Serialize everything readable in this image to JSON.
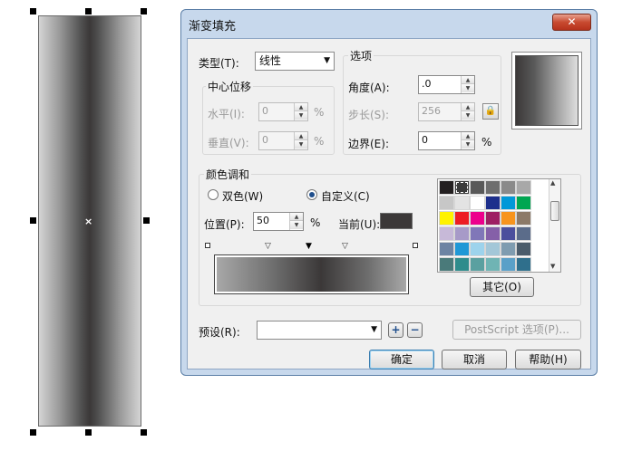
{
  "dialog": {
    "title": "渐变填充",
    "close_glyph": "✕",
    "type_label": "类型(T):",
    "type_value": "线性",
    "center_offset": {
      "group_label": "中心位移",
      "horizontal_label": "水平(I):",
      "horizontal_value": "0",
      "vertical_label": "垂直(V):",
      "vertical_value": "0",
      "percent": "%"
    },
    "options": {
      "group_label": "选项",
      "angle_label": "角度(A):",
      "angle_value": ".0",
      "steps_label": "步长(S):",
      "steps_value": "256",
      "edge_label": "边界(E):",
      "edge_value": "0",
      "percent": "%"
    },
    "color_blend": {
      "group_label": "颜色调和",
      "two_color_label": "双色(W)",
      "custom_label": "自定义(C)",
      "selected": "custom",
      "position_label": "位置(P):",
      "position_value": "50",
      "percent": "%",
      "current_label": "当前(U):",
      "current_color": "#3b3838",
      "other_button": "其它(O)"
    },
    "palette": [
      "#231f20",
      "#3a3a3a",
      "#595959",
      "#6e6e6e",
      "#8a8a8a",
      "#a8a8a8",
      "#c7c7c7",
      "#e3e3e3",
      "#ffffff",
      "#1d2f8c",
      "#0098d8",
      "#00a651",
      "#fff200",
      "#ed1c24",
      "#ec008c",
      "#9e1f63",
      "#f7941d",
      "#8c7a68",
      "#c7b9d8",
      "#a79ac8",
      "#8077b8",
      "#8560a8",
      "#4b4f9d",
      "#5b6c8a",
      "#6d84a3",
      "#1f98d6",
      "#9dd3ec",
      "#a3c7d8",
      "#7f9cb0",
      "#4b5c6b",
      "#4a7a7a",
      "#2f8c8c",
      "#5aa0a0",
      "#6fb4b4",
      "#5aa0c8",
      "#2f6f8c"
    ],
    "preset_label": "预设(R):",
    "preset_value": "",
    "postscript_button": "PostScript 选项(P)...",
    "ok_button": "确定",
    "cancel_button": "取消",
    "help_button": "帮助(H)",
    "add_preset_glyph": "+",
    "remove_preset_glyph": "−",
    "lock_glyph": "🔒"
  }
}
